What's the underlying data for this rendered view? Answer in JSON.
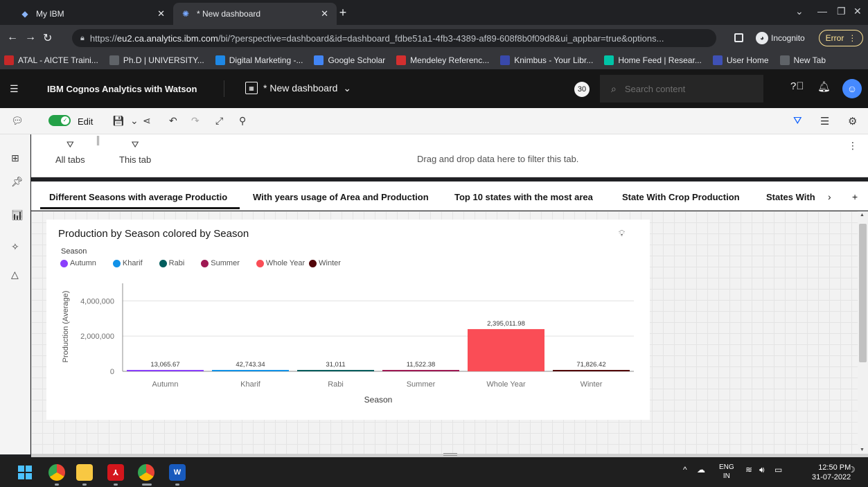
{
  "browser": {
    "tabs": [
      {
        "title": "My IBM",
        "icon": "ibm-icon"
      },
      {
        "title": "* New dashboard",
        "icon": "cognos-icon"
      }
    ],
    "url_prefix": "https://",
    "url_host": "eu2.ca.analytics.ibm.com",
    "url_rest": "/bi/?perspective=dashboard&id=dashboard_fdbe51a1-4fb3-4389-af89-608f8b0f09d8&ui_appbar=true&options...",
    "incognito_label": "Incognito",
    "error_label": "Error",
    "bookmarks": [
      {
        "label": "ATAL - AICTE Traini...",
        "color": "#c62828"
      },
      {
        "label": "Ph.D | UNIVERSITY...",
        "color": "#5f6368"
      },
      {
        "label": "Digital Marketing -...",
        "color": "#1e88e5"
      },
      {
        "label": "Google Scholar",
        "color": "#4285f4"
      },
      {
        "label": "Mendeley Referenc...",
        "color": "#d32f2f"
      },
      {
        "label": "Knimbus - Your Libr...",
        "color": "#3949ab"
      },
      {
        "label": "Home Feed | Resear...",
        "color": "#00c4a7"
      },
      {
        "label": "User Home",
        "color": "#3f51b5"
      },
      {
        "label": "New Tab",
        "color": "#5f6368"
      }
    ]
  },
  "app": {
    "product_prefix": "IBM ",
    "product_name": "Cognos Analytics with Watson",
    "dashboard_title": "* New dashboard",
    "notification_count": "30",
    "search_placeholder": "Search content"
  },
  "toolbar": {
    "edit_label": "Edit"
  },
  "filters": {
    "all_tabs": "All tabs",
    "this_tab": "This tab",
    "drop_hint": "Drag and drop data here to filter this tab."
  },
  "dashboard_tabs": [
    "Different Seasons with average Productio",
    "With years usage of Area and Production",
    "Top 10 states with the most area",
    "State With Crop Production",
    "States With"
  ],
  "widget": {
    "title": "Production by Season colored by Season",
    "legend_title": "Season"
  },
  "chart_data": {
    "type": "bar",
    "title": "Production by Season colored by Season",
    "xlabel": "Season",
    "ylabel": "Production (Average)",
    "categories": [
      "Autumn",
      "Kharif",
      "Rabi",
      "Summer",
      "Whole Year",
      "Winter"
    ],
    "values": [
      13065.67,
      42743.34,
      31011,
      11522.38,
      2395011.98,
      71826.42
    ],
    "value_labels": [
      "13,065.67",
      "42,743.34",
      "31,011",
      "11,522.38",
      "2,395,011.98",
      "71,826.42"
    ],
    "colors": [
      "#8a3ffc",
      "#1192e8",
      "#005d5d",
      "#9f1853",
      "#fa4d56",
      "#520408"
    ],
    "yticks": [
      0,
      2000000,
      4000000
    ],
    "ytick_labels": [
      "0",
      "2,000,000",
      "4,000,000"
    ],
    "ylim": [
      0,
      4600000
    ],
    "legend": {
      "title": "Season",
      "placement": "top-left",
      "entries": [
        "Autumn",
        "Kharif",
        "Rabi",
        "Summer",
        "Whole Year",
        "Winter"
      ]
    },
    "grid": true
  },
  "taskbar": {
    "lang_top": "ENG",
    "lang_bottom": "IN",
    "time": "12:50 PM",
    "date": "31-07-2022"
  }
}
